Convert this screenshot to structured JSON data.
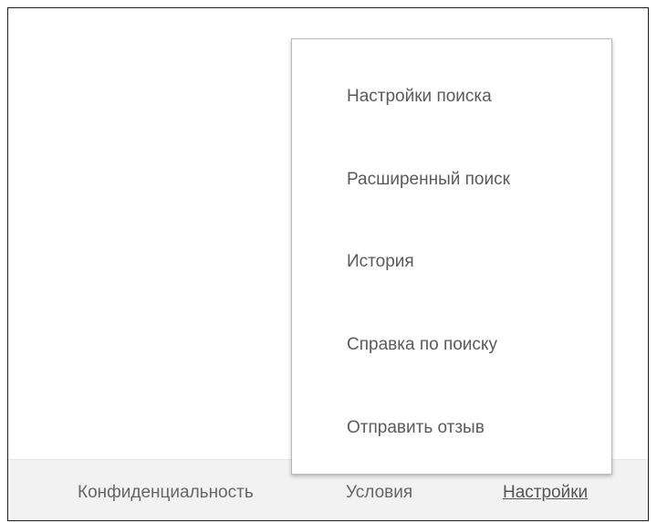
{
  "dropdown_menu": {
    "items": [
      {
        "label": "Настройки поиска"
      },
      {
        "label": "Расширенный поиск"
      },
      {
        "label": "История"
      },
      {
        "label": "Справка по поиску"
      },
      {
        "label": "Отправить отзыв"
      }
    ]
  },
  "footer": {
    "privacy_label": "Конфиденциальность",
    "terms_label": "Условия",
    "settings_label": "Настройки"
  },
  "colors": {
    "footer_background": "#f2f2f2",
    "menu_background": "#ffffff",
    "text": "#666666"
  }
}
